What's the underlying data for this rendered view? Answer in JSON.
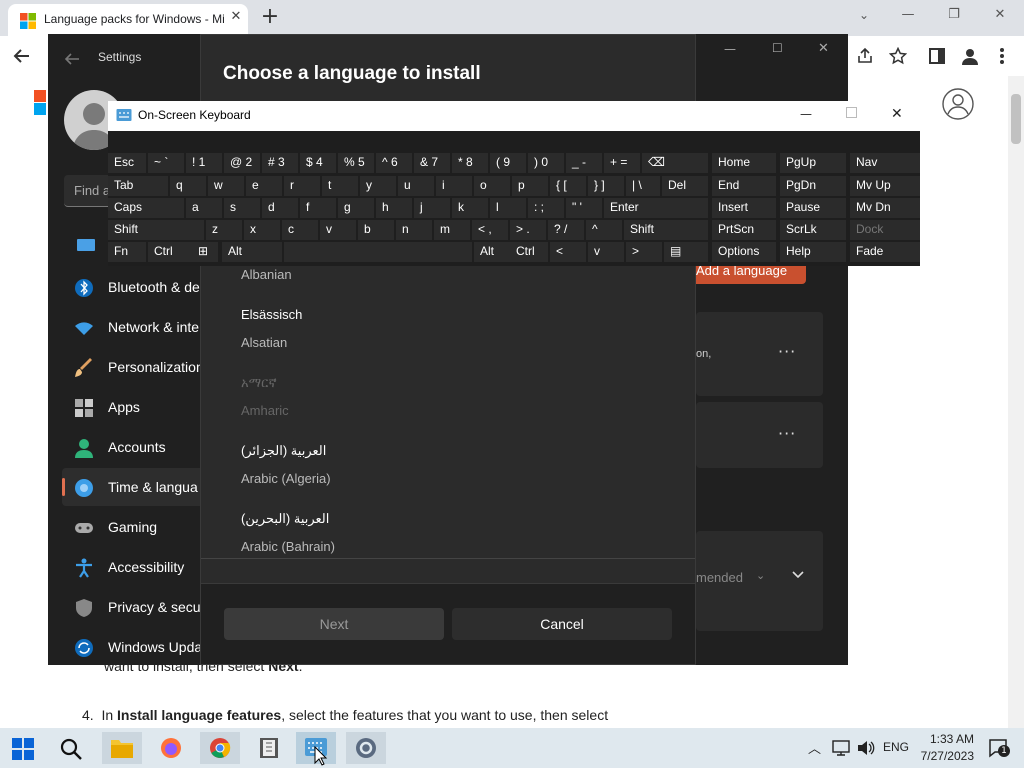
{
  "browser": {
    "tab_title": "Language packs for Windows - Microsoft Support",
    "tab_close": "✕",
    "new_tab": "+",
    "minimize": "—",
    "restore": "❐",
    "close": "✕"
  },
  "page": {
    "step3_tail": "want to install, then select",
    "step3_bold": "Next",
    "step4_num": "4.",
    "step4_pre": "In",
    "step4_bold": "Install language features",
    "step4_post": ", select the features that you want to use, then select"
  },
  "settings": {
    "title": "Settings",
    "search_placeholder": "Find a",
    "nav": [
      {
        "label": "Bluetooth & de",
        "icon": "bluetooth-icon"
      },
      {
        "label": "Network & inte",
        "icon": "network-icon"
      },
      {
        "label": "Personalization",
        "icon": "brush-icon"
      },
      {
        "label": "Apps",
        "icon": "apps-icon"
      },
      {
        "label": "Accounts",
        "icon": "accounts-icon"
      },
      {
        "label": "Time & langua",
        "icon": "time-language-icon"
      },
      {
        "label": "Gaming",
        "icon": "gaming-icon"
      },
      {
        "label": "Accessibility",
        "icon": "accessibility-icon"
      },
      {
        "label": "Privacy & secu",
        "icon": "shield-icon"
      },
      {
        "label": "Windows Upda",
        "icon": "update-icon"
      }
    ],
    "add_language": "Add a language",
    "option_tail": "on,",
    "recommended": "mended"
  },
  "dialog": {
    "title": "Choose a language to install",
    "languages": [
      {
        "native": "",
        "english": "Albanian",
        "dim": false
      },
      {
        "native": "Elsässisch",
        "english": "Alsatian",
        "dim": false
      },
      {
        "native": "አማርኛ",
        "english": "Amharic",
        "dim": true
      },
      {
        "native": "العربية (الجزائر)",
        "english": "Arabic (Algeria)",
        "dim": false
      },
      {
        "native": "العربية (البحرين)",
        "english": "Arabic (Bahrain)",
        "dim": false
      }
    ],
    "next": "Next",
    "cancel": "Cancel"
  },
  "osk": {
    "title": "On-Screen Keyboard",
    "minimize": "—",
    "close": "✕",
    "rows": [
      [
        "Esc",
        "~ `",
        "! 1",
        "@ 2",
        "# 3",
        "$ 4",
        "% 5",
        "^ 6",
        "& 7",
        "* 8",
        "( 9",
        ") 0",
        "_ -",
        "+ =",
        "⌫"
      ],
      [
        "Tab",
        "q",
        "w",
        "e",
        "r",
        "t",
        "y",
        "u",
        "i",
        "o",
        "p",
        "{ [",
        "} ]",
        "| \\",
        "Del"
      ],
      [
        "Caps",
        "a",
        "s",
        "d",
        "f",
        "g",
        "h",
        "j",
        "k",
        "l",
        ": ;",
        "\" '",
        "Enter"
      ],
      [
        "Shift",
        "z",
        "x",
        "c",
        "v",
        "b",
        "n",
        "m",
        "< ,",
        "> .",
        "? /",
        "^",
        "Shift"
      ],
      [
        "Fn",
        "Ctrl",
        "⊞",
        "Alt",
        "",
        "Alt",
        "Ctrl",
        "<",
        "v",
        ">",
        "▤"
      ]
    ],
    "nav_keys": [
      [
        "Home",
        "PgUp",
        "Nav"
      ],
      [
        "End",
        "PgDn",
        "Mv Up"
      ],
      [
        "Insert",
        "Pause",
        "Mv Dn"
      ],
      [
        "PrtScn",
        "ScrLk",
        "Dock"
      ],
      [
        "Options",
        "Help",
        "Fade"
      ]
    ]
  },
  "taskbar": {
    "lang": "ENG",
    "time": "1:33 AM",
    "date": "7/27/2023",
    "notif_count": "1"
  }
}
